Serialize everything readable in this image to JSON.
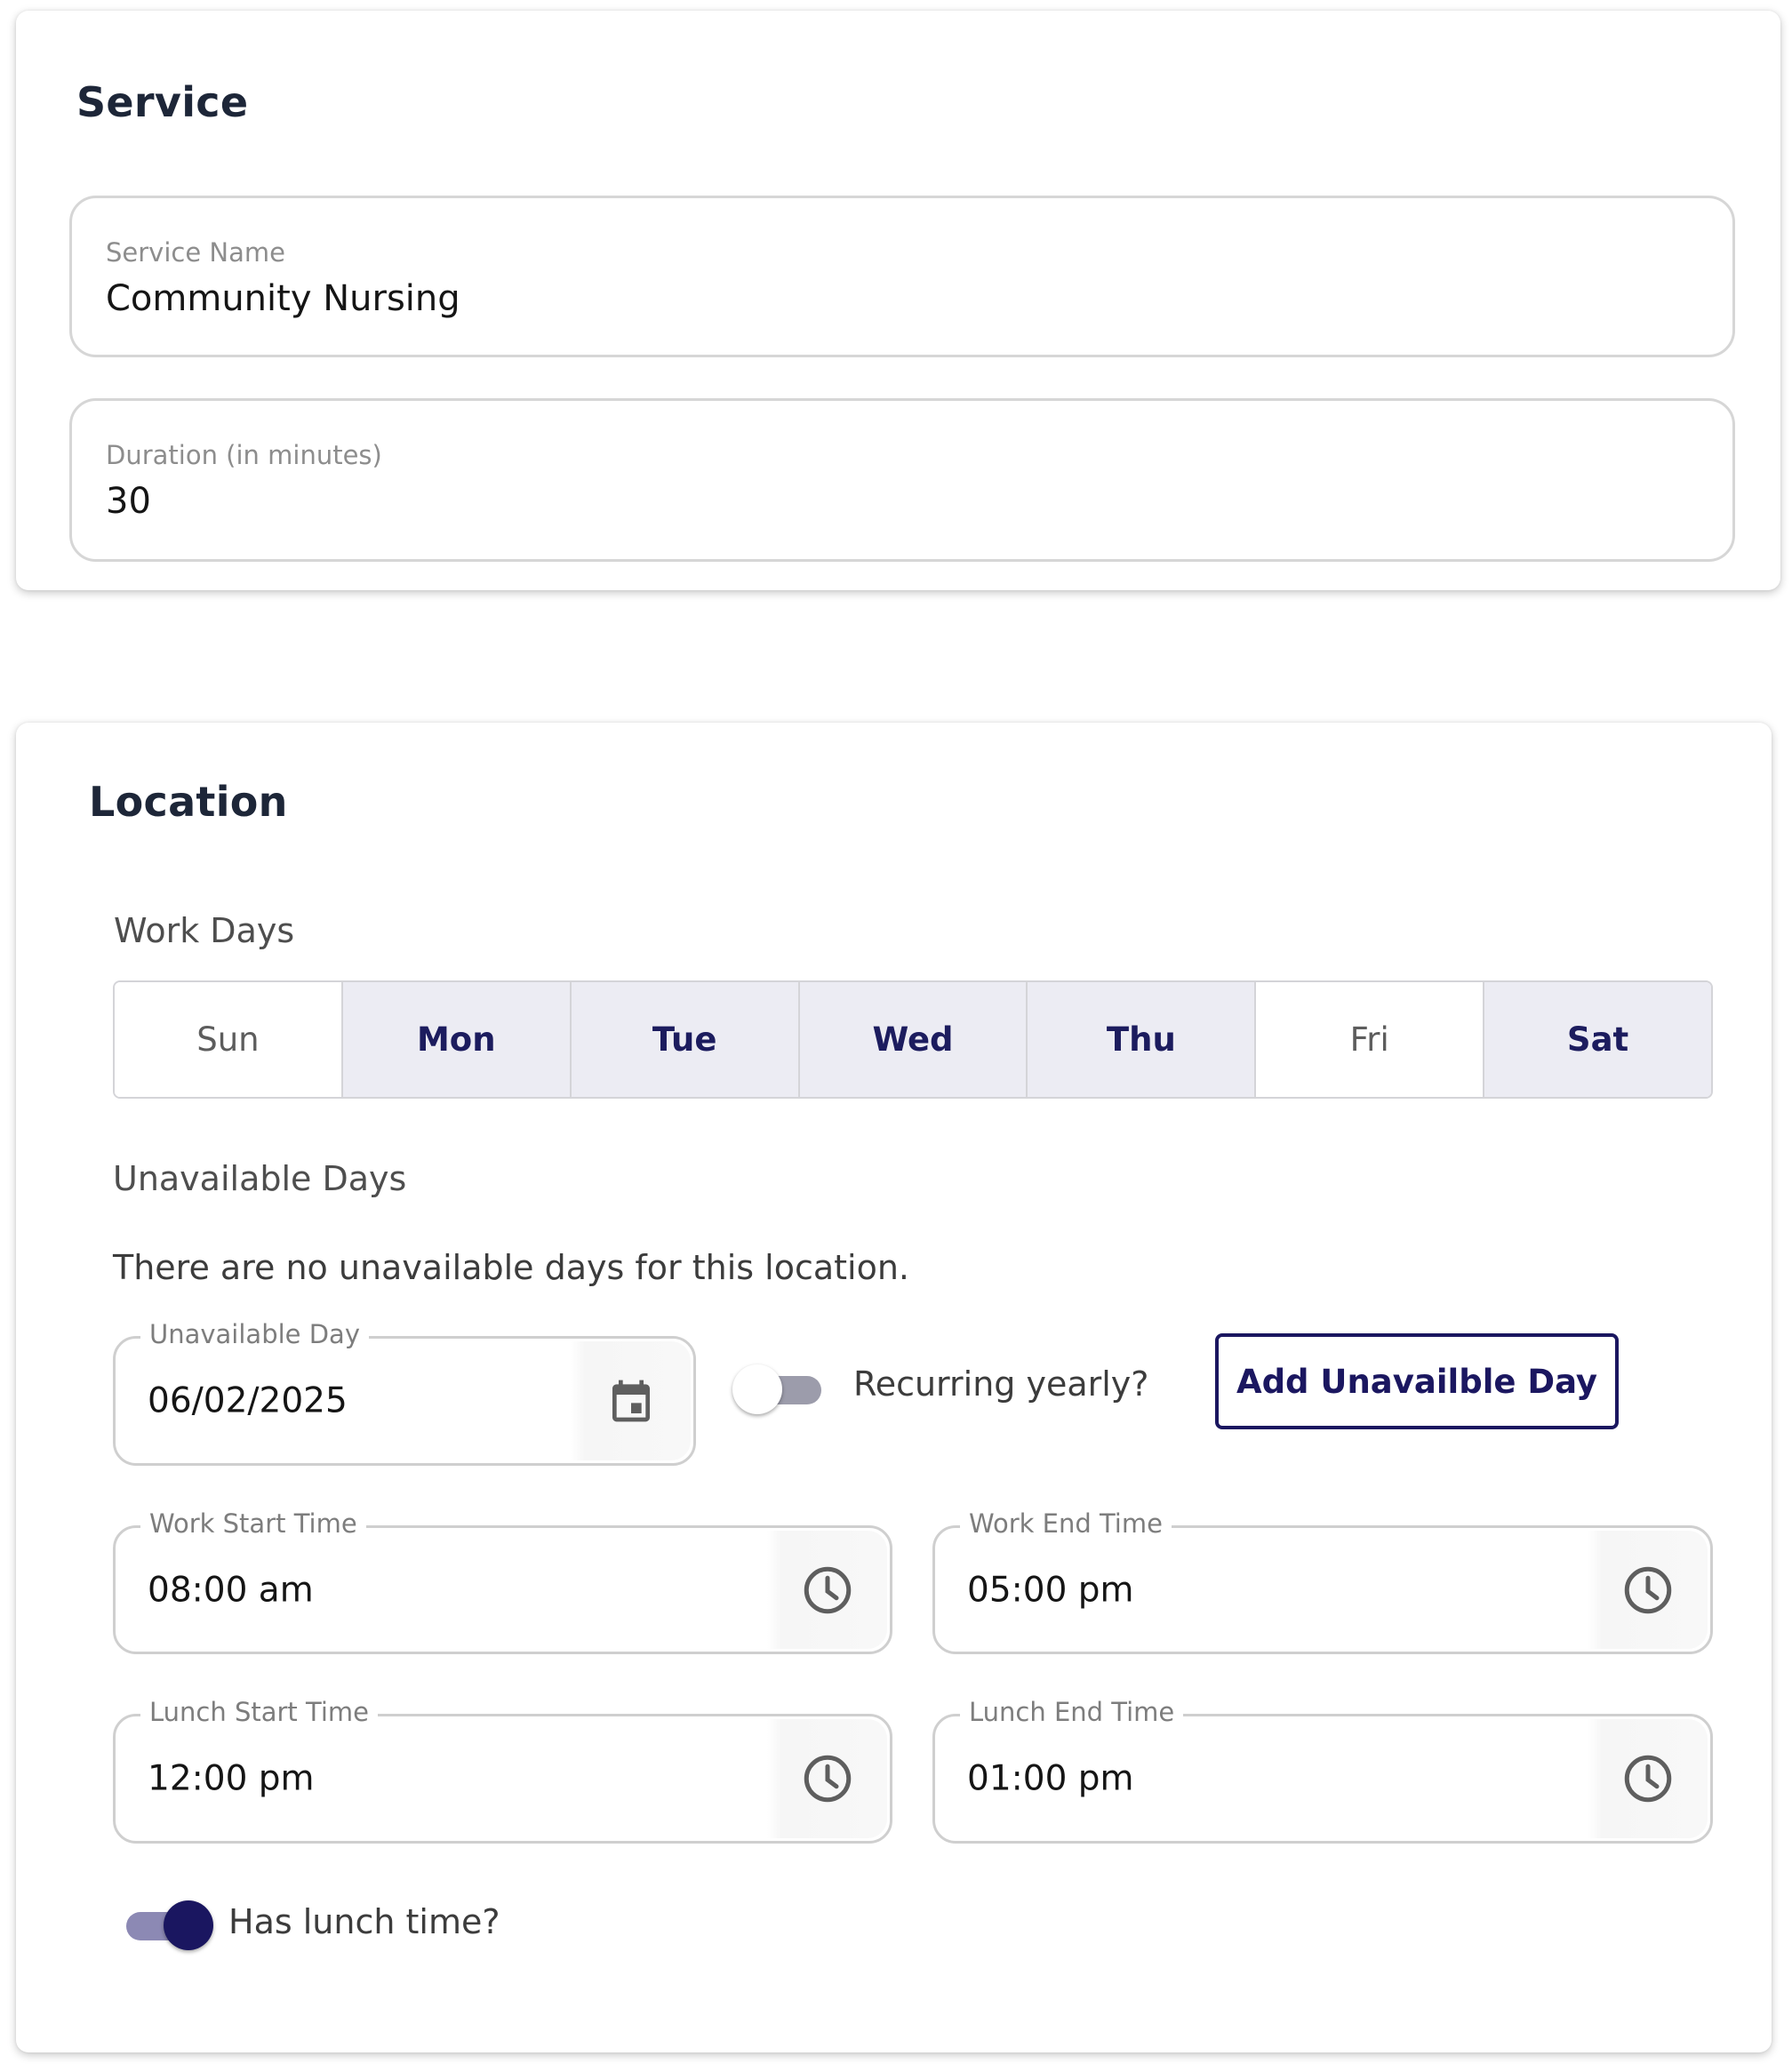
{
  "service": {
    "title": "Service",
    "service_name": {
      "label": "Service Name",
      "value": "Community Nursing"
    },
    "duration": {
      "label": "Duration (in minutes)",
      "value": "30"
    }
  },
  "location": {
    "title": "Location",
    "work_days_label": "Work Days",
    "days": [
      {
        "label": "Sun",
        "selected": false
      },
      {
        "label": "Mon",
        "selected": true
      },
      {
        "label": "Tue",
        "selected": true
      },
      {
        "label": "Wed",
        "selected": true
      },
      {
        "label": "Thu",
        "selected": true
      },
      {
        "label": "Fri",
        "selected": false
      },
      {
        "label": "Sat",
        "selected": true
      }
    ],
    "unavailable_days_label": "Unavailable Days",
    "no_unavailable_text": "There are no unavailable days for this location.",
    "unavailable_day": {
      "label": "Unavailable Day",
      "value": "06/02/2025",
      "icon": "calendar-icon"
    },
    "recurring_yearly": {
      "label": "Recurring yearly?",
      "checked": false
    },
    "add_button_label": "Add Unavailble Day",
    "work_start": {
      "label": "Work Start Time",
      "value": "08:00 am",
      "icon": "clock-icon"
    },
    "work_end": {
      "label": "Work End Time",
      "value": "05:00 pm",
      "icon": "clock-icon"
    },
    "lunch_start": {
      "label": "Lunch Start Time",
      "value": "12:00 pm",
      "icon": "clock-icon"
    },
    "lunch_end": {
      "label": "Lunch End Time",
      "value": "01:00 pm",
      "icon": "clock-icon"
    },
    "has_lunch": {
      "label": "Has lunch time?",
      "checked": true
    }
  },
  "colors": {
    "primary": "#1b1760",
    "selected_day_bg": "#ececf3",
    "title_text": "#1d2638",
    "border": "#d6d6d6"
  }
}
